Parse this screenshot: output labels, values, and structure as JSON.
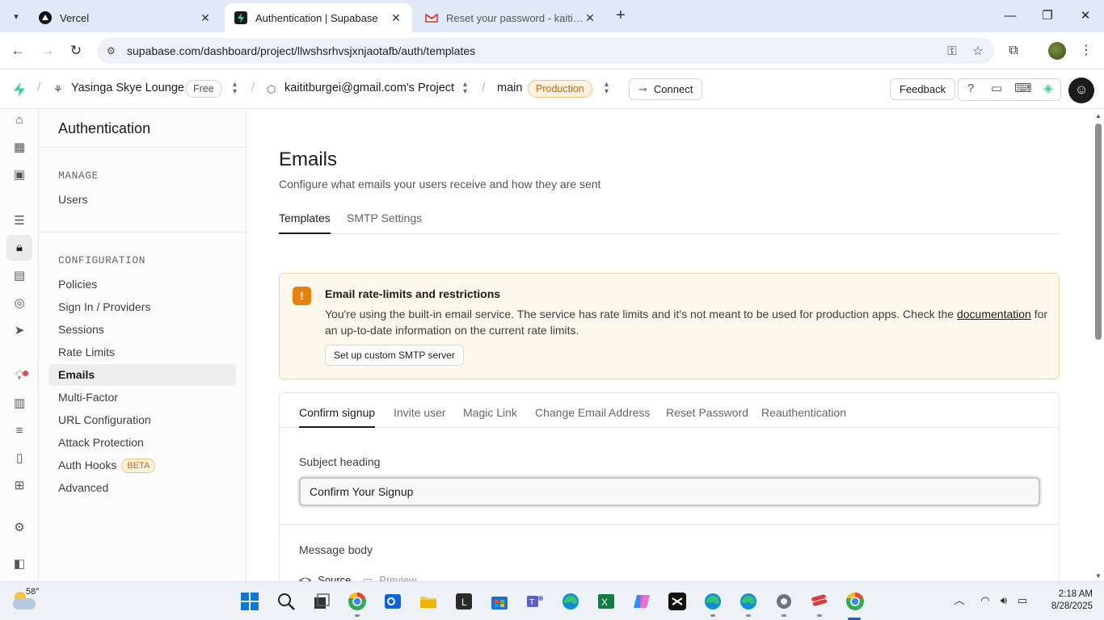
{
  "browser": {
    "tabs": [
      {
        "title": "Vercel",
        "icon": "vercel-icon"
      },
      {
        "title": "Authentication | Supabase",
        "icon": "supabase-icon"
      },
      {
        "title": "Reset your password - kaititbur",
        "icon": "gmail-icon"
      }
    ],
    "url": "supabase.com/dashboard/project/llwshsrhvsjxnjaotafb/auth/templates"
  },
  "topbar": {
    "org_name": "Yasinga Skye Lounge",
    "org_plan": "Free",
    "project_name": "kaititburgei@gmail.com's Project",
    "branch": "main",
    "env": "Production",
    "connect_label": "Connect",
    "feedback_label": "Feedback"
  },
  "sidebar": {
    "title": "Authentication",
    "manage_heading": "MANAGE",
    "manage_items": [
      "Users"
    ],
    "config_heading": "CONFIGURATION",
    "config_items": [
      {
        "label": "Policies"
      },
      {
        "label": "Sign In / Providers"
      },
      {
        "label": "Sessions"
      },
      {
        "label": "Rate Limits"
      },
      {
        "label": "Emails",
        "active": true
      },
      {
        "label": "Multi-Factor"
      },
      {
        "label": "URL Configuration"
      },
      {
        "label": "Attack Protection"
      },
      {
        "label": "Auth Hooks",
        "badge": "BETA"
      },
      {
        "label": "Advanced"
      }
    ]
  },
  "main": {
    "title": "Emails",
    "subtitle": "Configure what emails your users receive and how they are sent",
    "tabs": [
      "Templates",
      "SMTP Settings"
    ],
    "alert": {
      "title": "Email rate-limits and restrictions",
      "body_1": "You're using the built-in email service. The service has rate limits and it's not meant to be used for production apps. Check the ",
      "link": "documentation",
      "body_2": " for an up-to-date information on the current rate limits.",
      "button": "Set up custom SMTP server"
    },
    "template_tabs": [
      "Confirm signup",
      "Invite user",
      "Magic Link",
      "Change Email Address",
      "Reset Password",
      "Reauthentication"
    ],
    "subject_label": "Subject heading",
    "subject_value": "Confirm Your Signup",
    "message_label": "Message body",
    "source_label": "Source",
    "preview_label": "Preview"
  },
  "taskbar": {
    "temperature": "58°",
    "time": "2:18 AM",
    "date": "8/28/2025"
  },
  "colors": {
    "supabase_green": "#3ecf8e",
    "warning_orange": "#e5820f",
    "alert_bg": "#fff8ed"
  }
}
